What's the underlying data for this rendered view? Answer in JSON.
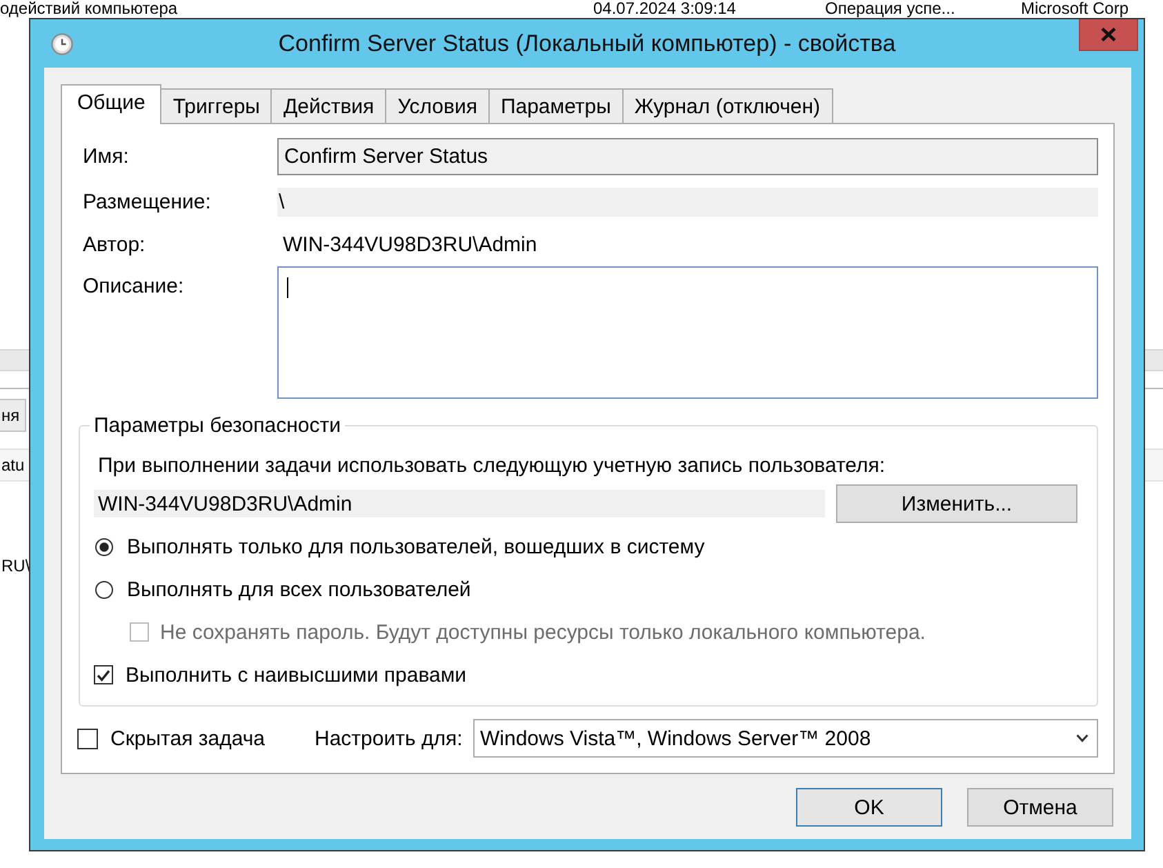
{
  "background_window": {
    "top_row": [
      "одействий компьютера",
      "04.07.2024 3:09:14",
      "Операция успе...",
      "Microsoft Corp"
    ],
    "column_header": "ня",
    "rows": [
      "atu",
      "RU\\"
    ]
  },
  "dialog": {
    "title": "Confirm Server Status (Локальный компьютер) - свойства",
    "tabs": [
      {
        "label": "Общие",
        "selected": true
      },
      {
        "label": "Триггеры",
        "selected": false
      },
      {
        "label": "Действия",
        "selected": false
      },
      {
        "label": "Условия",
        "selected": false
      },
      {
        "label": "Параметры",
        "selected": false
      },
      {
        "label": "Журнал (отключен)",
        "selected": false
      }
    ],
    "fields": [
      {
        "kind": "input",
        "label": "Имя:",
        "value": "Confirm Server Status",
        "focused": false
      },
      {
        "kind": "readonly",
        "label": "Размещение:",
        "value": "\\",
        "focused": false
      },
      {
        "kind": "text",
        "label": "Автор:",
        "value": "WIN-344VU98D3RU\\Admin",
        "focused": false
      },
      {
        "kind": "textarea",
        "label": "Описание:",
        "focused": true
      }
    ],
    "security": {
      "title": "Параметры безопасности",
      "prompt": "При выполнении задачи использовать следующую учетную запись пользователя:",
      "account": "WIN-344VU98D3RU\\Admin",
      "change_button": "Изменить...",
      "logon_options": [
        {
          "label": "Выполнять только для пользователей, вошедших в систему",
          "selected": true
        },
        {
          "label": "Выполнять для всех пользователей",
          "selected": false,
          "children": [
            {
              "label": "Не сохранять пароль. Будут доступны ресурсы только локального компьютера.",
              "checked": false,
              "disabled": true
            }
          ]
        }
      ],
      "highest_privileges": {
        "label": "Выполнить с наивысшими правами",
        "checked": true
      }
    },
    "hidden_task": {
      "label": "Скрытая задача",
      "checked": false
    },
    "configure_for": {
      "label": "Настроить для:",
      "value": "Windows Vista™, Windows Server™ 2008"
    },
    "buttons": [
      {
        "label": "OK",
        "default": true
      },
      {
        "label": "Отмена",
        "default": false
      }
    ]
  }
}
